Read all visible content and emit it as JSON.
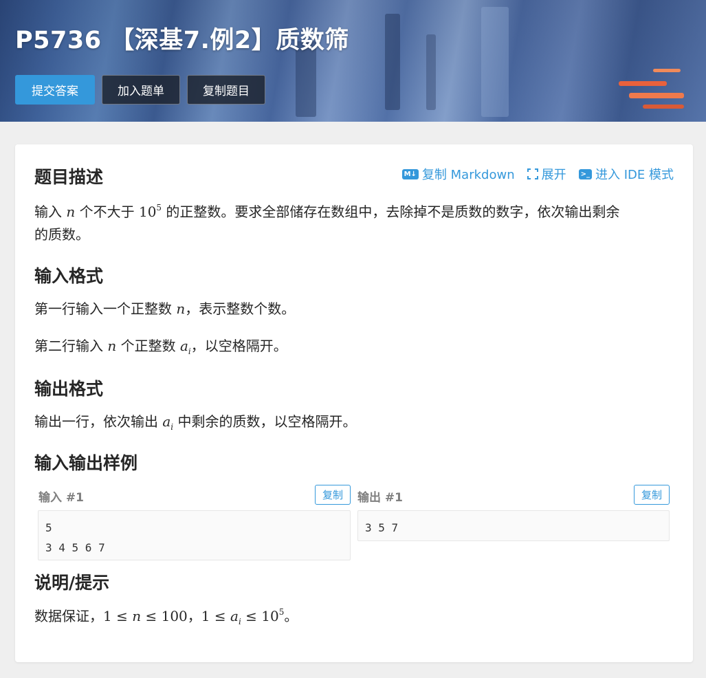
{
  "header": {
    "title": "P5736 【深基7.例2】质数筛",
    "buttons": {
      "submit": "提交答案",
      "add_to_list": "加入题单",
      "copy_problem": "复制题目"
    },
    "colors": {
      "primary": "#3498db"
    }
  },
  "toolbar": {
    "copy_markdown": {
      "icon": "M↓",
      "label": "复制 Markdown"
    },
    "expand": {
      "label": "展开"
    },
    "ide_mode": {
      "icon": ">_",
      "label": "进入 IDE 模式"
    }
  },
  "sections": {
    "description": {
      "heading": "题目描述",
      "line1_a": "输入 ",
      "line1_var": "n",
      "line1_b": " 个不大于 ",
      "line1_num": "10",
      "line1_exp": "5",
      "line1_c": " 的正整数。要求全部储存在数组中，去除掉不是质数的数字，依次输出剩余",
      "line2": "的质数。"
    },
    "input_format": {
      "heading": "输入格式",
      "p1_a": "第一行输入一个正整数 ",
      "p1_var": "n",
      "p1_b": "，表示整数个数。",
      "p2_a": "第二行输入 ",
      "p2_var": "n",
      "p2_b": " 个正整数 ",
      "p2_var2": "a",
      "p2_sub": "i",
      "p2_c": "，以空格隔开。"
    },
    "output_format": {
      "heading": "输出格式",
      "p1_a": "输出一行，依次输出 ",
      "p1_var": "a",
      "p1_sub": "i",
      "p1_b": " 中剩余的质数，以空格隔开。"
    },
    "samples": {
      "heading": "输入输出样例",
      "input_label": "输入 #1",
      "output_label": "输出 #1",
      "copy_label": "复制",
      "input_text": "5\n3 4 5 6 7",
      "output_text": "3 5 7"
    },
    "hint": {
      "heading": "说明/提示",
      "a": "数据保证，",
      "one1": "1",
      "le1": " ≤ ",
      "var_n": "n",
      "le2": " ≤ ",
      "hundred": "100",
      "comma": "，",
      "one2": "1",
      "le3": " ≤ ",
      "var_a": "a",
      "sub_i": "i",
      "le4": " ≤ ",
      "ten": "10",
      "exp": "5",
      "end": "。"
    }
  }
}
